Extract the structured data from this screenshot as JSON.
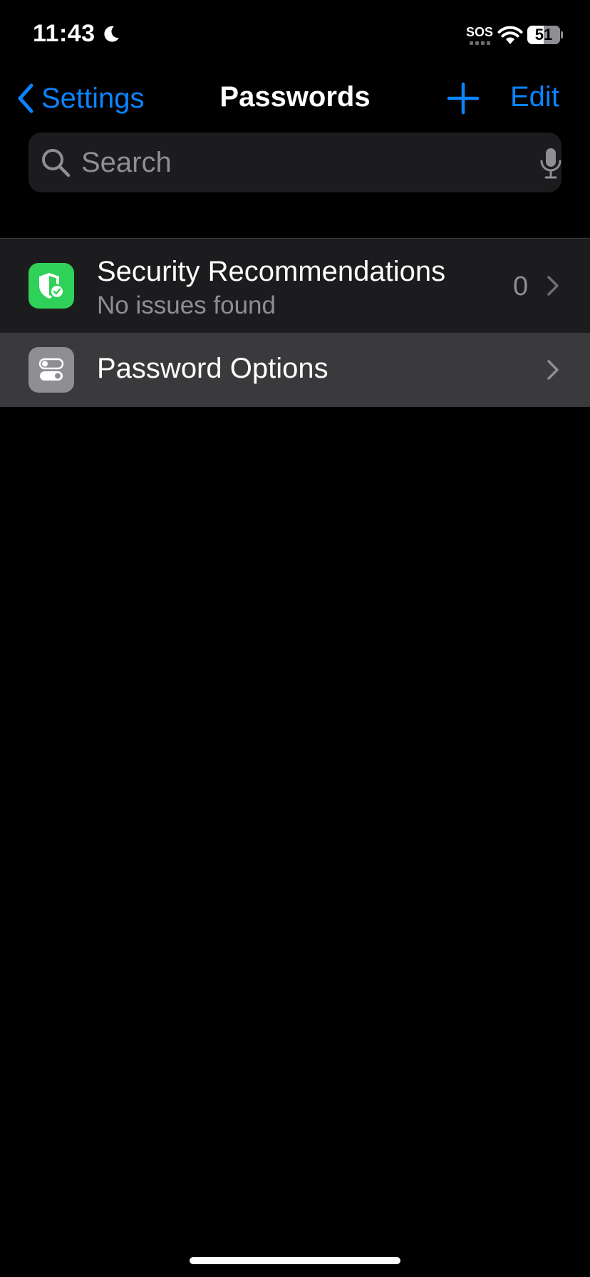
{
  "status_bar": {
    "time": "11:43",
    "sos": "SOS",
    "battery_level": "51",
    "battery_fraction": 0.51,
    "icons": [
      "moon-icon",
      "wifi-icon",
      "battery-icon"
    ]
  },
  "nav": {
    "back_label": "Settings",
    "title": "Passwords",
    "edit_label": "Edit",
    "icons": [
      "chevron-left-icon",
      "plus-icon"
    ]
  },
  "search": {
    "placeholder": "Search",
    "value": "",
    "icons": [
      "search-icon",
      "mic-icon"
    ]
  },
  "list": {
    "items": [
      {
        "title": "Security Recommendations",
        "subtitle": "No issues found",
        "count": "0",
        "icon": "shield-check-icon",
        "icon_color": "#30d158"
      },
      {
        "title": "Password Options",
        "icon": "toggles-icon",
        "icon_color": "#8e8e93"
      }
    ]
  },
  "colors": {
    "accent": "#0a84ff",
    "background": "#000000",
    "row_background": "#1c1c1e",
    "row_highlight": "#3a3a3c",
    "secondary_text": "#8e8e93"
  }
}
